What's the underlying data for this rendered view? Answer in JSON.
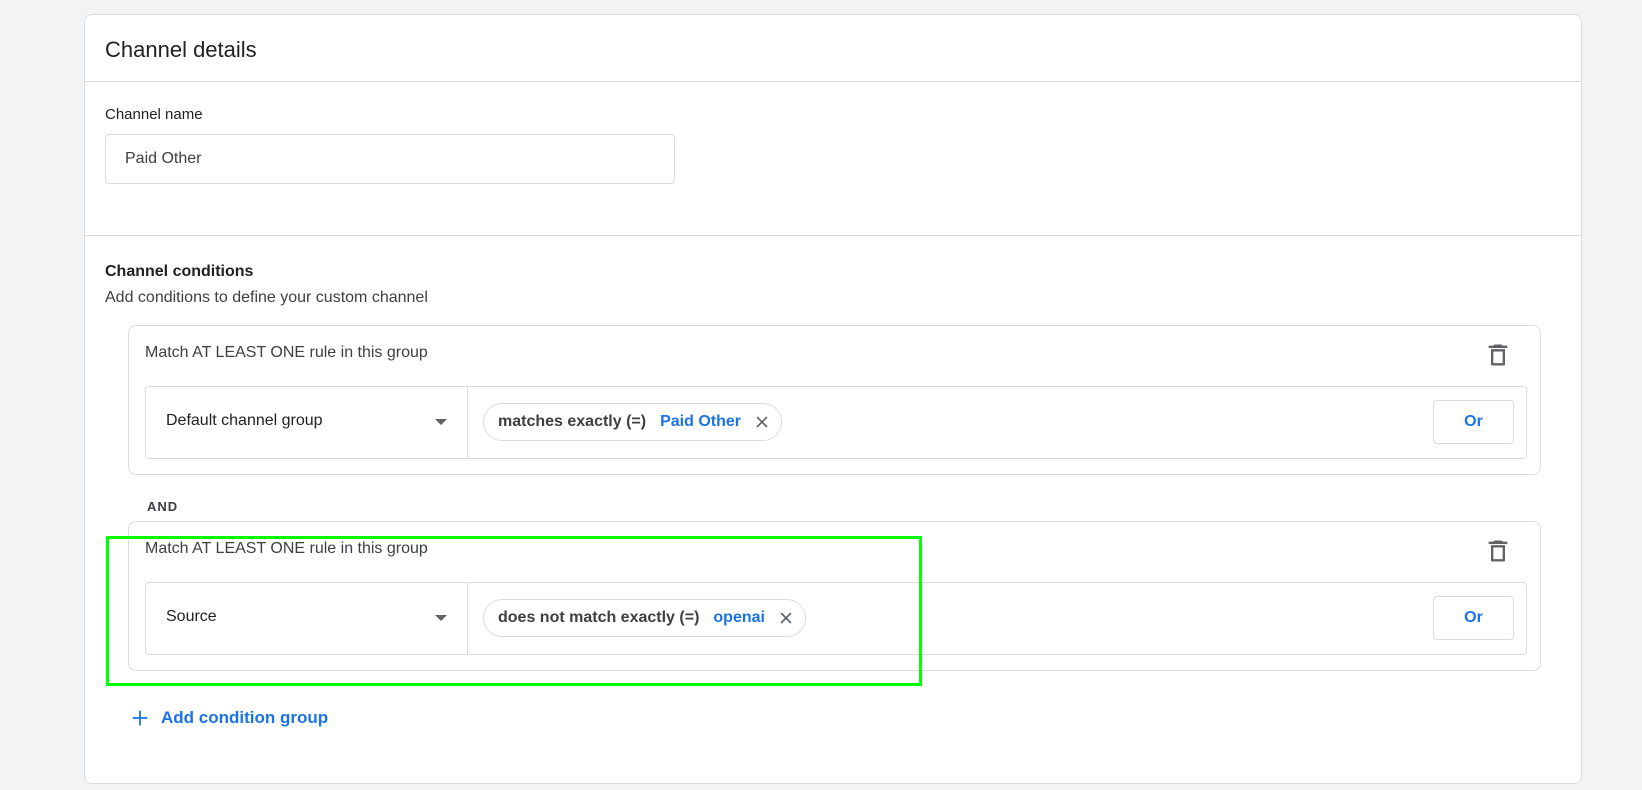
{
  "details": {
    "title": "Channel details",
    "name_label": "Channel name",
    "name_value": "Paid Other"
  },
  "conditions": {
    "title": "Channel conditions",
    "subtitle": "Add conditions to define your custom channel",
    "and_label": "AND",
    "add_group_label": "Add condition group",
    "groups": [
      {
        "title": "Match AT LEAST ONE rule in this group",
        "dimension": "Default channel group",
        "operator": "matches exactly (=)",
        "value": "Paid Other",
        "or_label": "Or"
      },
      {
        "title": "Match AT LEAST ONE rule in this group",
        "dimension": "Source",
        "operator": "does not match exactly (=)",
        "value": "openai",
        "or_label": "Or"
      }
    ]
  },
  "colors": {
    "accent": "#1a73e8",
    "highlight": "#00ff00",
    "border": "#dadce0"
  },
  "icons": {
    "delete": "trash-icon",
    "remove_chip": "close-icon",
    "dropdown": "caret-down-icon",
    "add": "plus-icon"
  }
}
